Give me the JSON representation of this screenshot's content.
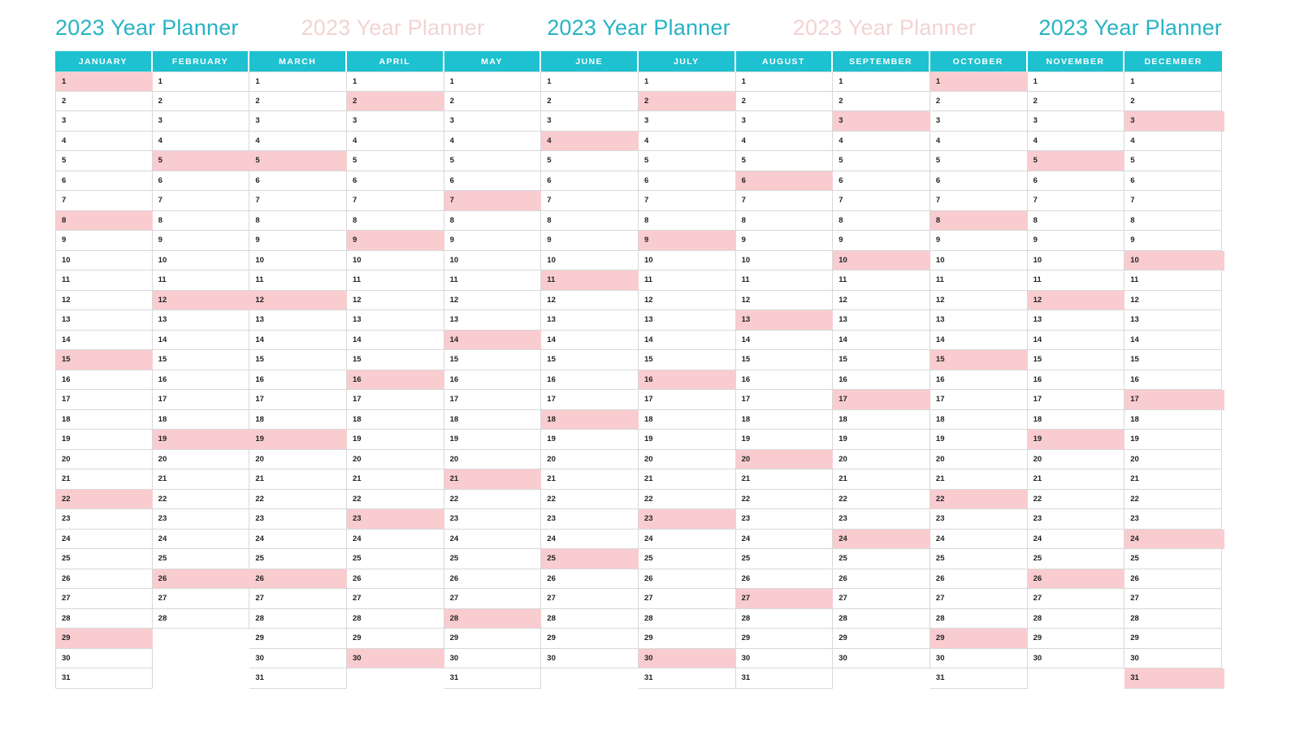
{
  "titles": [
    {
      "text": "2023 Year Planner",
      "color": "#27b3c4"
    },
    {
      "text": "2023 Year Planner",
      "color": "#f3d3d4"
    },
    {
      "text": "2023 Year Planner",
      "color": "#27b3c4"
    },
    {
      "text": "2023 Year Planner",
      "color": "#f3d3d4"
    },
    {
      "text": "2023 Year Planner",
      "color": "#27b3c4"
    }
  ],
  "year": 2023,
  "colors": {
    "header_teal": "#1ec1cf",
    "title_accent": "#27b3c4",
    "title_ghost": "#f3d3d4",
    "highlight_pink": "#f9ccd0",
    "grid_line": "#d8d8d8",
    "cell_background": "#ffffff",
    "day_number": "#222222"
  },
  "months": [
    {
      "name": "JANUARY",
      "days": 31,
      "highlighted_days": [
        1,
        8,
        15,
        22,
        29
      ]
    },
    {
      "name": "FEBRUARY",
      "days": 28,
      "highlighted_days": [
        5,
        12,
        19,
        26
      ]
    },
    {
      "name": "MARCH",
      "days": 31,
      "highlighted_days": [
        5,
        12,
        19,
        26
      ]
    },
    {
      "name": "APRIL",
      "days": 30,
      "highlighted_days": [
        2,
        9,
        16,
        23,
        30
      ]
    },
    {
      "name": "MAY",
      "days": 31,
      "highlighted_days": [
        7,
        14,
        21,
        28
      ]
    },
    {
      "name": "JUNE",
      "days": 30,
      "highlighted_days": [
        4,
        11,
        18,
        25
      ]
    },
    {
      "name": "JULY",
      "days": 31,
      "highlighted_days": [
        2,
        9,
        16,
        23,
        30
      ]
    },
    {
      "name": "AUGUST",
      "days": 31,
      "highlighted_days": [
        6,
        13,
        20,
        27
      ]
    },
    {
      "name": "SEPTEMBER",
      "days": 30,
      "highlighted_days": [
        3,
        10,
        17,
        24
      ]
    },
    {
      "name": "OCTOBER",
      "days": 31,
      "highlighted_days": [
        1,
        8,
        15,
        22,
        29
      ]
    },
    {
      "name": "NOVEMBER",
      "days": 30,
      "highlighted_days": [
        5,
        12,
        19,
        26
      ]
    },
    {
      "name": "DECEMBER",
      "days": 31,
      "highlighted_days": [
        3,
        10,
        17,
        24,
        31
      ]
    }
  ],
  "max_rows": 31
}
